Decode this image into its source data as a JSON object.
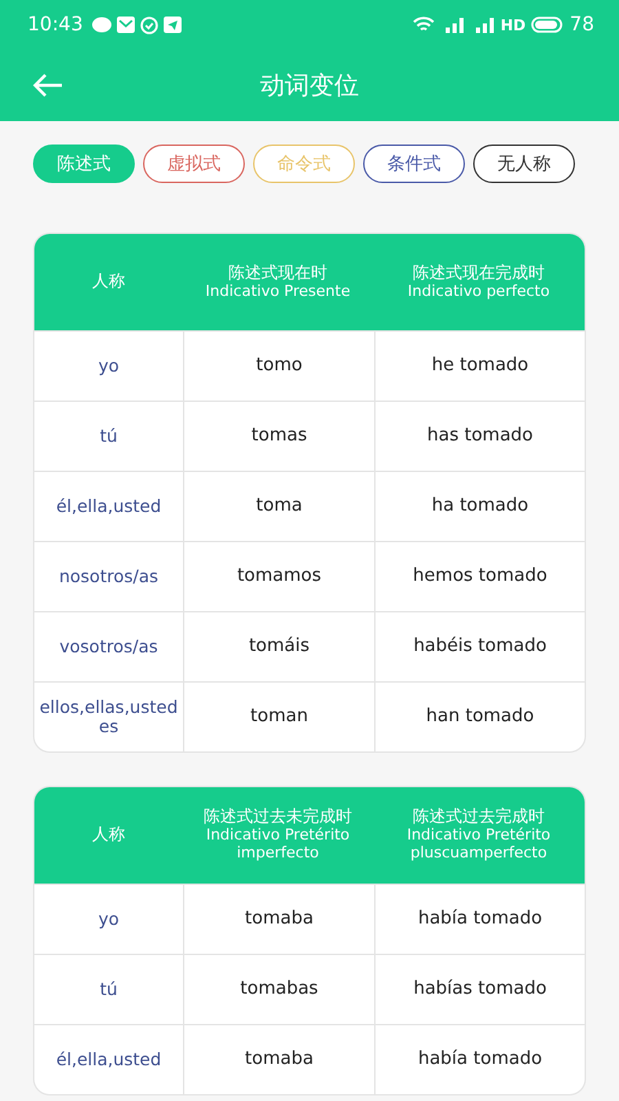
{
  "status_bar": {
    "time": "10:43",
    "network": "HD",
    "battery": "78"
  },
  "header": {
    "title": "动词变位"
  },
  "tabs": [
    {
      "label": "陈述式",
      "selected": true,
      "color": "#16cc8c"
    },
    {
      "label": "虚拟式",
      "selected": false,
      "color": "#d9665f"
    },
    {
      "label": "命令式",
      "selected": false,
      "color": "#e8c46a"
    },
    {
      "label": "条件式",
      "selected": false,
      "color": "#4a5aa8"
    },
    {
      "label": "无人称",
      "selected": false,
      "color": "#333333"
    }
  ],
  "tables": [
    {
      "columns": [
        {
          "zh": "人称"
        },
        {
          "zh": "陈述式现在时",
          "es": "Indicativo Presente"
        },
        {
          "zh": "陈述式现在完成时",
          "es": "Indicativo perfecto"
        }
      ],
      "rows": [
        [
          "yo",
          "tomo",
          "he tomado"
        ],
        [
          "tú",
          "tomas",
          "has tomado"
        ],
        [
          "él,ella,usted",
          "toma",
          "ha tomado"
        ],
        [
          "nosotros/as",
          "tomamos",
          "hemos tomado"
        ],
        [
          "vosotros/as",
          "tomáis",
          "habéis tomado"
        ],
        [
          "ellos,ellas,ustedes",
          "toman",
          "han tomado"
        ]
      ]
    },
    {
      "columns": [
        {
          "zh": "人称"
        },
        {
          "zh": "陈述式过去未完成时",
          "es": "Indicativo Pretérito imperfecto"
        },
        {
          "zh": "陈述式过去完成时",
          "es": "Indicativo Pretérito pluscuamperfecto"
        }
      ],
      "rows": [
        [
          "yo",
          "tomaba",
          "había tomado"
        ],
        [
          "tú",
          "tomabas",
          "habías tomado"
        ],
        [
          "él,ella,usted",
          "tomaba",
          "había tomado"
        ]
      ]
    }
  ]
}
